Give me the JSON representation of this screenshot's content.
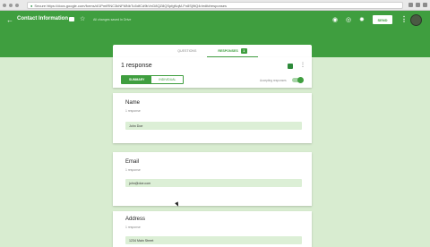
{
  "browser": {
    "url": "Secure  https://docs.google.com/forms/d/1PmtRNC3kNFMNbTu5dfCd9kVnD8QZ8QSpfgNqM-Fn8Sj9tQ4r/edit#responses"
  },
  "appbar": {
    "back_icon": "arrow-left-icon",
    "title": "Contact Information",
    "saved_text": "All changes saved in Drive",
    "send_label": "SEND",
    "more_label": "⋮"
  },
  "tabs": {
    "questions_label": "QUESTIONS",
    "responses_label": "RESPONSES",
    "responses_count": "1"
  },
  "summary": {
    "response_count_label": "1 response",
    "summary_label": "SUMMARY",
    "individual_label": "INDIVIDUAL",
    "accepting_label": "Accepting responses"
  },
  "questions": [
    {
      "label": "Name",
      "sub": "1 response",
      "answer": "John Doe"
    },
    {
      "label": "Email",
      "sub": "1 response",
      "answer": "john@doe.com"
    },
    {
      "label": "Address",
      "sub": "1 response",
      "answer": "1234 Main Street"
    }
  ],
  "colors": {
    "brand_green": "#3f9e3f",
    "page_bg": "#d8ecd0",
    "answer_bg": "#dcefd6"
  }
}
